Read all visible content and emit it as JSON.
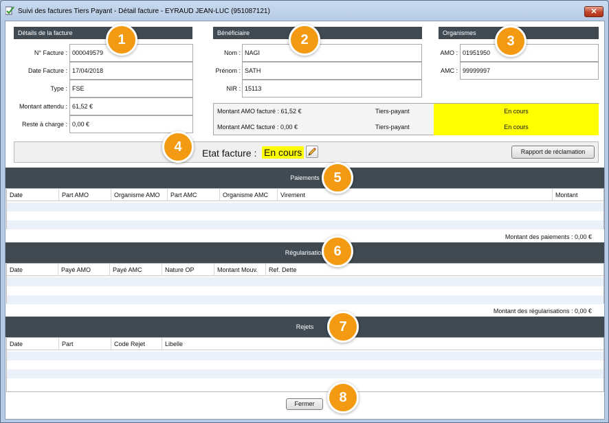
{
  "window": {
    "title": "Suivi des factures Tiers Payant - Détail facture - EYRAUD JEAN-LUC (951087121)",
    "close": "✕"
  },
  "facture": {
    "header": "Détails de la facture",
    "fields": [
      {
        "label": "N° Facture :",
        "value": "000049579"
      },
      {
        "label": "Date Facture :",
        "value": "17/04/2018"
      },
      {
        "label": "Type :",
        "value": "FSE"
      },
      {
        "label": "Montant attendu :",
        "value": "61,52 €"
      },
      {
        "label": "Reste à charge :",
        "value": "0,00 €"
      }
    ]
  },
  "beneficiaire": {
    "header": "Bénéficiaire",
    "fields": [
      {
        "label": "Nom :",
        "value": "NAGI"
      },
      {
        "label": "Prénom :",
        "value": "SATH"
      },
      {
        "label": "NIR :",
        "value": "15113"
      }
    ]
  },
  "organismes": {
    "header": "Organismes",
    "fields": [
      {
        "label": "AMO :",
        "value": "01951950"
      },
      {
        "label": "AMC :",
        "value": "99999997"
      }
    ]
  },
  "billing": [
    {
      "label": "Montant AMO facturé : 61,52 €",
      "type": "Tiers-payant",
      "status": "En cours"
    },
    {
      "label": "Montant AMC facturé : 0,00 €",
      "type": "Tiers-payant",
      "status": "En cours"
    }
  ],
  "etat": {
    "label": "Etat facture :",
    "value": "En cours",
    "rapport_button": "Rapport de réclamation"
  },
  "paiements": {
    "title": "Paiements",
    "columns": [
      "Date",
      "Part AMO",
      "Organisme AMO",
      "Part AMC",
      "Organisme AMC",
      "Virement",
      "Montant"
    ],
    "total": "Montant des paiements : 0,00 €"
  },
  "regularisation": {
    "title": "Régularisation",
    "columns": [
      "Date",
      "Payé AMO",
      "Payé AMC",
      "Nature OP",
      "Montant Mouv.",
      "Ref. Dette"
    ],
    "total": "Montant des régularisations : 0,00 €"
  },
  "rejets": {
    "title": "Rejets",
    "columns": [
      "Date",
      "Part",
      "Code Rejet",
      "Libelle"
    ]
  },
  "footer": {
    "close_button": "Fermer"
  },
  "badges": [
    "1",
    "2",
    "3",
    "4",
    "5",
    "6",
    "7",
    "8"
  ],
  "colors": {
    "header_dark": "#3f4a53",
    "highlight": "#ffff00",
    "badge": "#f39a12",
    "row_stripe": "#eaf1fa"
  }
}
